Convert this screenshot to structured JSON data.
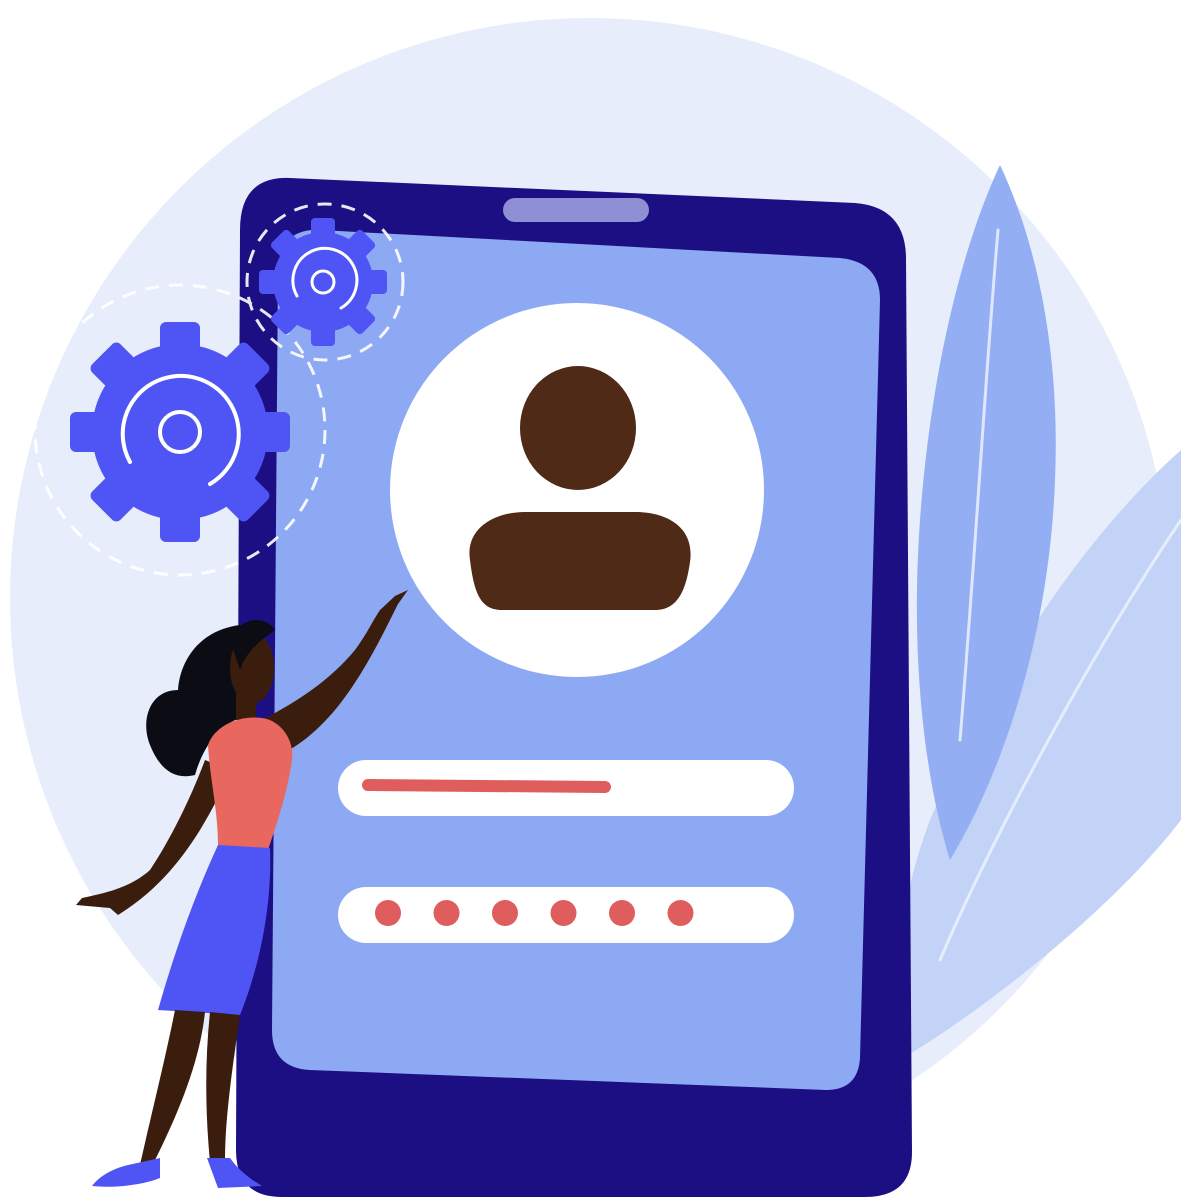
{
  "illustration": {
    "subject": "mobile-login-profile",
    "icons": [
      "gear-icon",
      "gear-icon",
      "user-avatar-icon"
    ],
    "colors": {
      "background_circle": "#e7edfb",
      "leaf_dark": "#93aef2",
      "leaf_light": "#c3d3f7",
      "phone_body": "#1c0f83",
      "phone_screen": "#8ea9f4",
      "notch": "#8f8fd6",
      "avatar_bg": "#ffffff",
      "avatar_figure": "#4e2a17",
      "field_bg": "#ffffff",
      "field_accent": "#e05d5d",
      "gear": "#4f55f5",
      "woman_skin": "#3b1d0e",
      "woman_top": "#e8675f",
      "woman_skirt": "#4f55f5",
      "woman_hair": "#0c0c14"
    }
  },
  "login_form": {
    "username_filled": true,
    "password_dot_count": 6
  }
}
